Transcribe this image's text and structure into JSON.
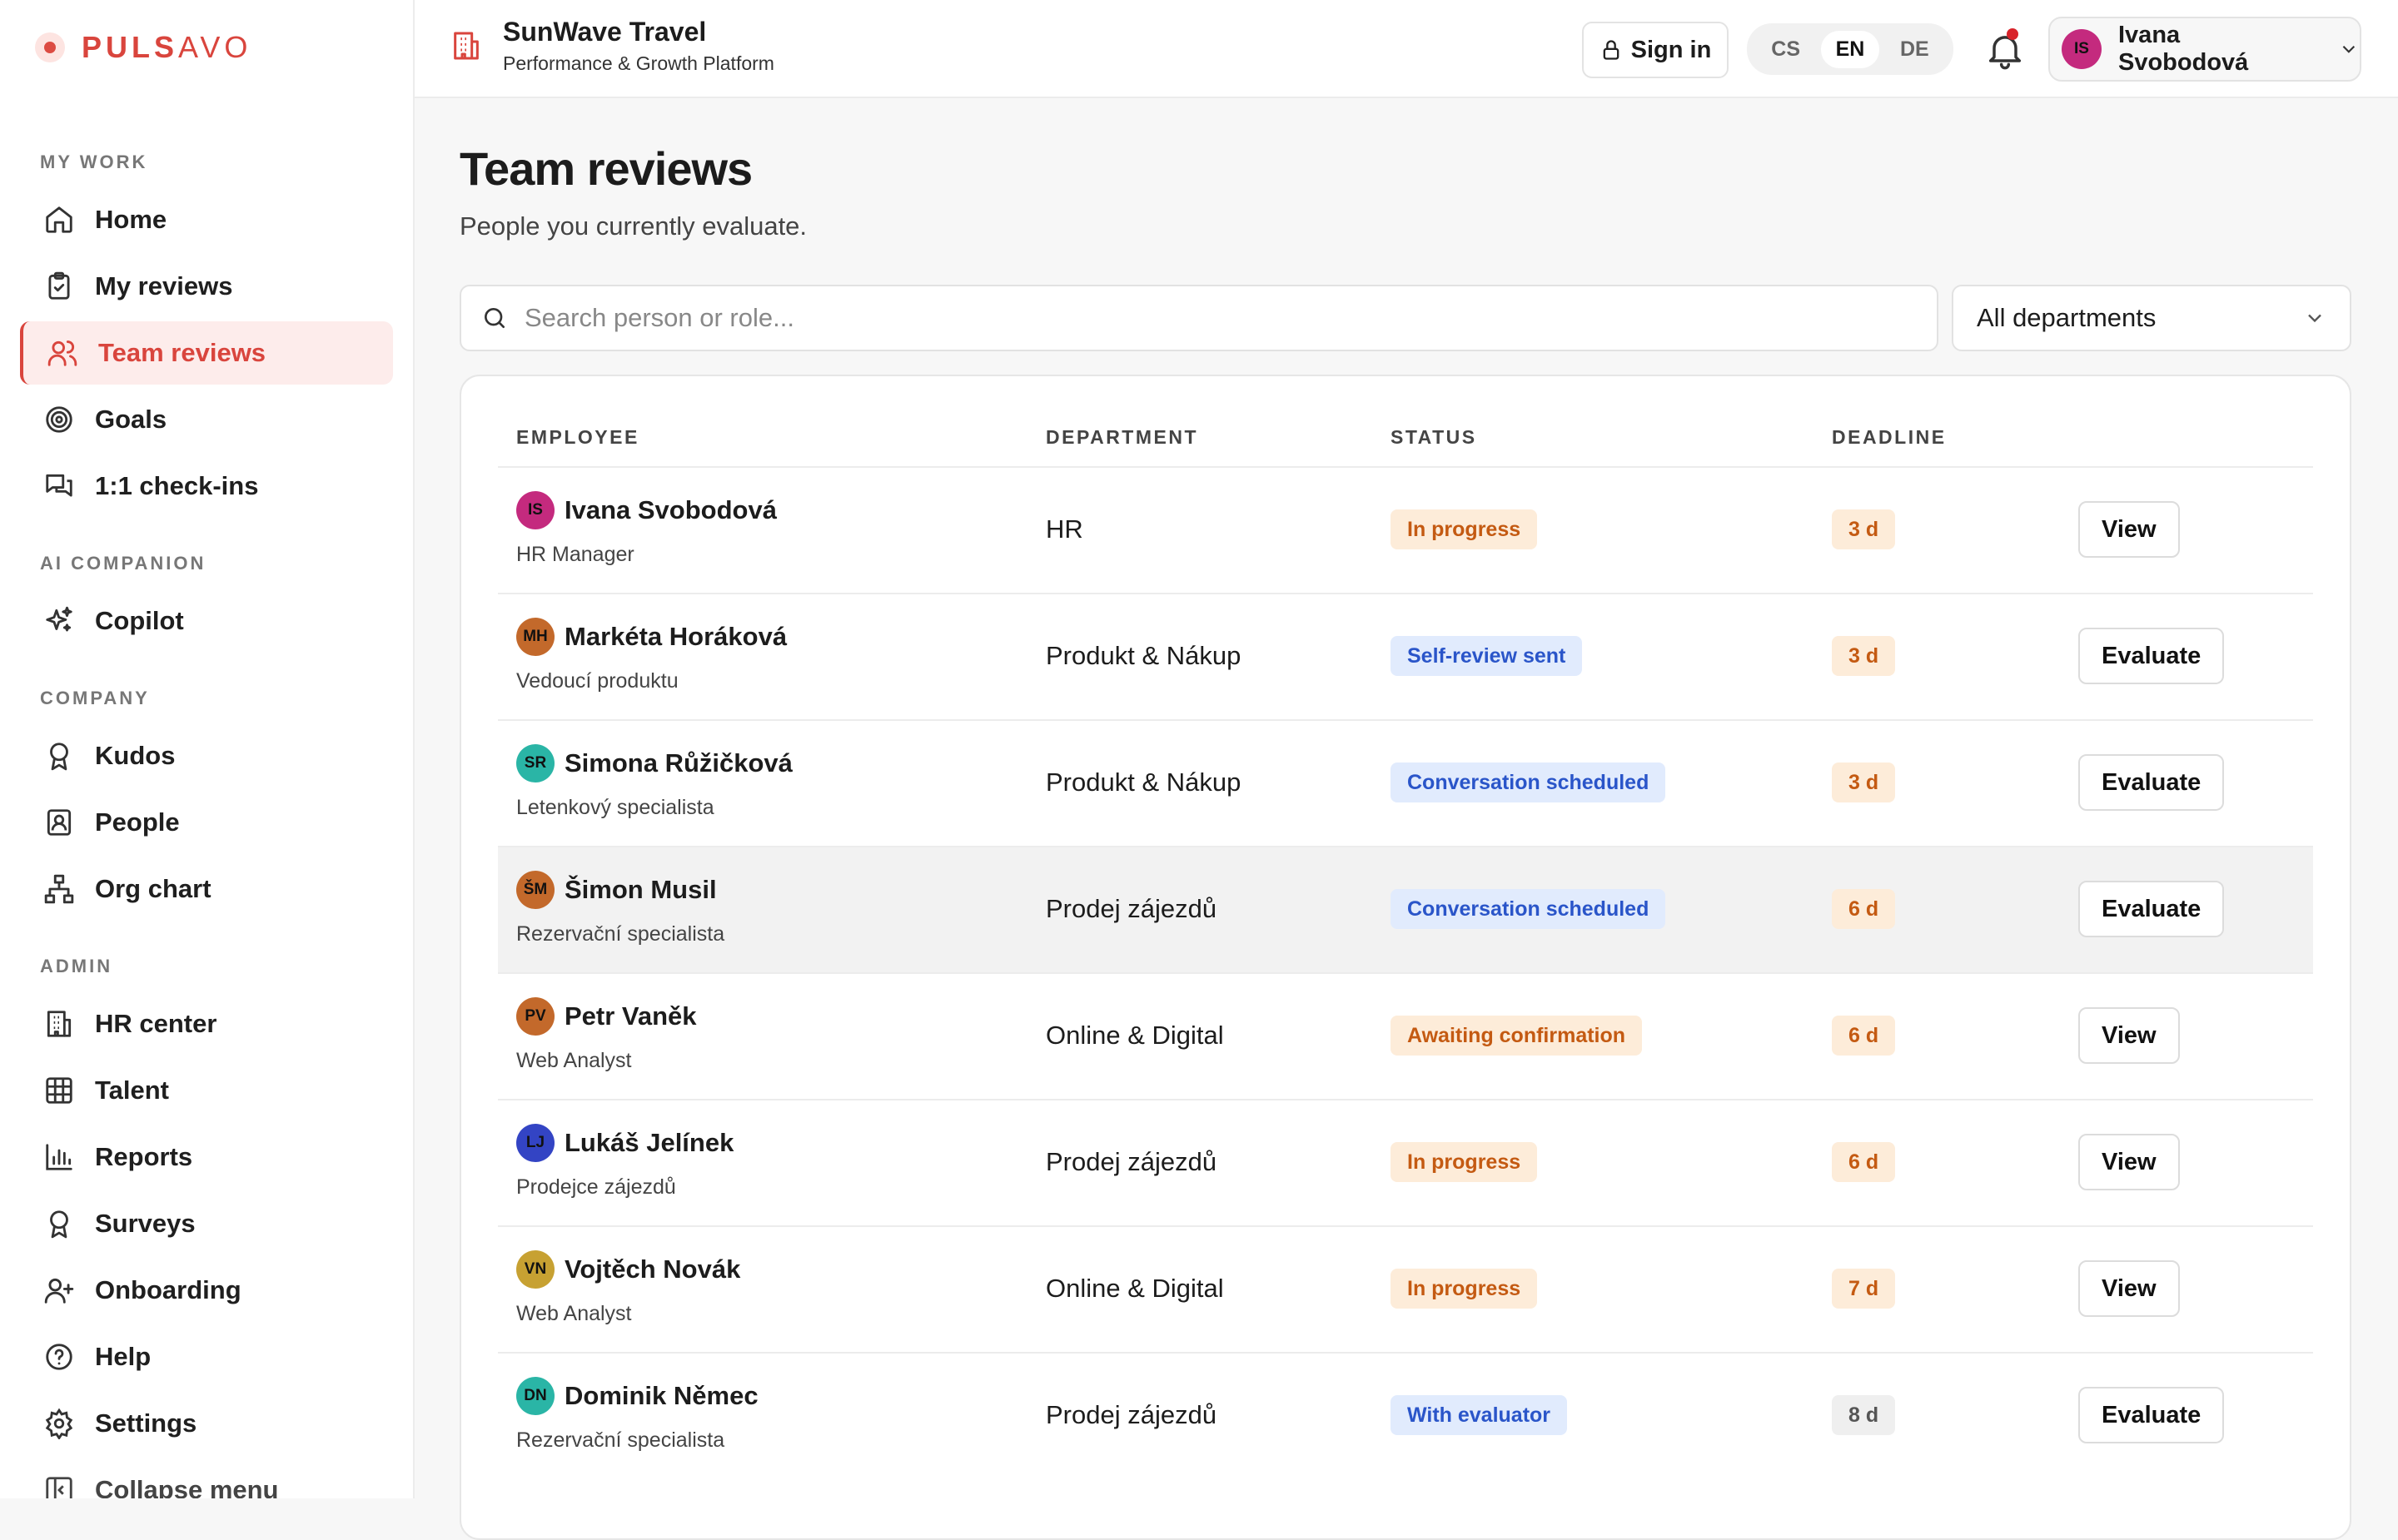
{
  "brand": {
    "logo_bold": "PULS",
    "logo_light": "AVO"
  },
  "org": {
    "name": "SunWave Travel",
    "subtitle": "Performance & Growth Platform"
  },
  "topbar": {
    "sign_in": "Sign in",
    "languages": [
      "CS",
      "EN",
      "DE"
    ],
    "selected_language": "EN",
    "user_initials": "IS",
    "user_name": "Ivana Svobodová"
  },
  "sidebar": {
    "sections": {
      "my_work": "MY WORK",
      "ai": "AI COMPANION",
      "company": "COMPANY",
      "admin": "ADMIN"
    },
    "items": [
      {
        "label": "Home",
        "icon": "home-icon"
      },
      {
        "label": "My reviews",
        "icon": "clipboard-icon"
      },
      {
        "label": "Team reviews",
        "icon": "users-icon"
      },
      {
        "label": "Goals",
        "icon": "target-icon"
      },
      {
        "label": "1:1 check-ins",
        "icon": "chat-icon"
      },
      {
        "label": "Copilot",
        "icon": "sparkles-icon"
      },
      {
        "label": "Kudos",
        "icon": "award-icon"
      },
      {
        "label": "People",
        "icon": "contact-icon"
      },
      {
        "label": "Org chart",
        "icon": "org-chart-icon"
      },
      {
        "label": "HR center",
        "icon": "building-icon"
      },
      {
        "label": "Talent",
        "icon": "grid-icon"
      },
      {
        "label": "Reports",
        "icon": "bar-chart-icon"
      },
      {
        "label": "Surveys",
        "icon": "award-icon"
      },
      {
        "label": "Onboarding",
        "icon": "user-plus-icon"
      },
      {
        "label": "Help",
        "icon": "help-icon"
      },
      {
        "label": "Settings",
        "icon": "gear-icon"
      },
      {
        "label": "Collapse menu",
        "icon": "collapse-icon"
      }
    ]
  },
  "page": {
    "title": "Team reviews",
    "subtitle": "People you currently evaluate.",
    "search_placeholder": "Search person or role...",
    "department_filter": "All departments"
  },
  "table": {
    "headers": {
      "employee": "EMPLOYEE",
      "department": "DEPARTMENT",
      "status": "STATUS",
      "deadline": "DEADLINE"
    },
    "rows": [
      {
        "initials": "IS",
        "avatar_color": "#c42a7e",
        "name": "Ivana Svobodová",
        "role": "HR Manager",
        "department": "HR",
        "status": "In progress",
        "status_kind": "orange",
        "deadline": "3 d",
        "deadline_kind": "orange",
        "action": "View"
      },
      {
        "initials": "MH",
        "avatar_color": "#c3692b",
        "name": "Markéta Horáková",
        "role": "Vedoucí produktu",
        "department": "Produkt & Nákup",
        "status": "Self-review sent",
        "status_kind": "blue",
        "deadline": "3 d",
        "deadline_kind": "orange",
        "action": "Evaluate"
      },
      {
        "initials": "SR",
        "avatar_color": "#2ab5a6",
        "name": "Simona Růžičková",
        "role": "Letenkový specialista",
        "department": "Produkt & Nákup",
        "status": "Conversation scheduled",
        "status_kind": "blue",
        "deadline": "3 d",
        "deadline_kind": "orange",
        "action": "Evaluate"
      },
      {
        "initials": "ŠM",
        "avatar_color": "#c3692b",
        "name": "Šimon Musil",
        "role": "Rezervační specialista",
        "department": "Prodej zájezdů",
        "status": "Conversation scheduled",
        "status_kind": "blue",
        "deadline": "6 d",
        "deadline_kind": "orange",
        "action": "Evaluate"
      },
      {
        "initials": "PV",
        "avatar_color": "#c3692b",
        "name": "Petr Vaněk",
        "role": "Web Analyst",
        "department": "Online & Digital",
        "status": "Awaiting confirmation",
        "status_kind": "orange",
        "deadline": "6 d",
        "deadline_kind": "orange",
        "action": "View"
      },
      {
        "initials": "LJ",
        "avatar_color": "#3344c4",
        "name": "Lukáš Jelínek",
        "role": "Prodejce zájezdů",
        "department": "Prodej zájezdů",
        "status": "In progress",
        "status_kind": "orange",
        "deadline": "6 d",
        "deadline_kind": "orange",
        "action": "View"
      },
      {
        "initials": "VN",
        "avatar_color": "#c7a132",
        "name": "Vojtěch Novák",
        "role": "Web Analyst",
        "department": "Online & Digital",
        "status": "In progress",
        "status_kind": "orange",
        "deadline": "7 d",
        "deadline_kind": "orange",
        "action": "View"
      },
      {
        "initials": "DN",
        "avatar_color": "#2ab5a6",
        "name": "Dominik Němec",
        "role": "Rezervační specialista",
        "department": "Prodej zájezdů",
        "status": "With evaluator",
        "status_kind": "blue",
        "deadline": "8 d",
        "deadline_kind": "grey",
        "action": "Evaluate"
      }
    ]
  }
}
